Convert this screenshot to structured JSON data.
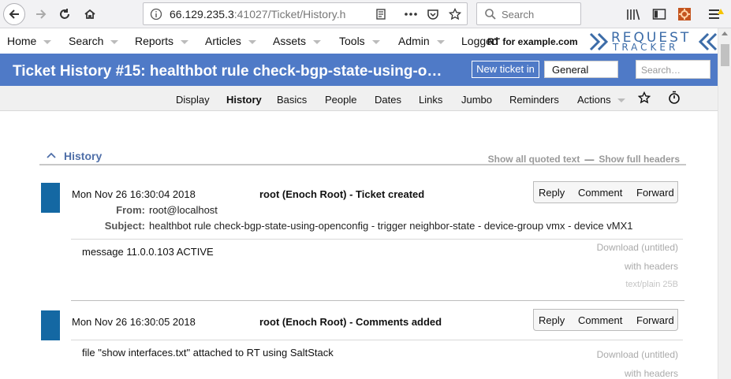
{
  "browser": {
    "url_host": "66.129.235.3",
    "url_rest": ":41027/Ticket/History.h",
    "search_placeholder": "Search"
  },
  "topmenu": {
    "items": [
      "Home",
      "Search",
      "Reports",
      "Articles",
      "Assets",
      "Tools",
      "Admin"
    ],
    "logged_in": "Logged",
    "logged_overlay": "RT for example.com",
    "logo_top": "REQUEST",
    "logo_bottom": "TRACKER"
  },
  "titlebar": {
    "title": "Ticket History #15: healthbot rule check-bgp-state-using-o…",
    "new_ticket_label": "New ticket in",
    "queue_value": "General",
    "search_placeholder": "Search…"
  },
  "pagemenu": {
    "items": [
      "Display",
      "History",
      "Basics",
      "People",
      "Dates",
      "Links",
      "Jumbo",
      "Reminders",
      "Actions"
    ],
    "active": "History"
  },
  "history": {
    "title": "History",
    "show_quoted": "Show all quoted text",
    "separator": "—",
    "show_headers": "Show full headers"
  },
  "transactions": [
    {
      "date": "Mon Nov 26 16:30:04 2018",
      "description": "root (Enoch Root) - Ticket created",
      "actions": [
        "Reply",
        "Comment",
        "Forward"
      ],
      "from_label": "From:",
      "from_value": "root@localhost",
      "subject_label": "Subject:",
      "subject_value": "healthbot rule check-bgp-state-using-openconfig - trigger neighbor-state - device-group vmx - device vMX1",
      "body": "message 11.0.0.103 ACTIVE",
      "attachment": {
        "download": "Download (untitled)",
        "with_headers": "with headers",
        "meta": "text/plain 25B"
      }
    },
    {
      "date": "Mon Nov 26 16:30:05 2018",
      "description": "root (Enoch Root) - Comments added",
      "actions": [
        "Reply",
        "Comment",
        "Forward"
      ],
      "body": "file \"show interfaces.txt\" attached to RT using SaltStack",
      "attachment": {
        "download": "Download (untitled)",
        "with_headers": "with headers"
      }
    }
  ],
  "colors": {
    "titlebar": "#4f7ac7",
    "txn_bar": "#1468a3",
    "history_title": "#4f6fa8"
  }
}
